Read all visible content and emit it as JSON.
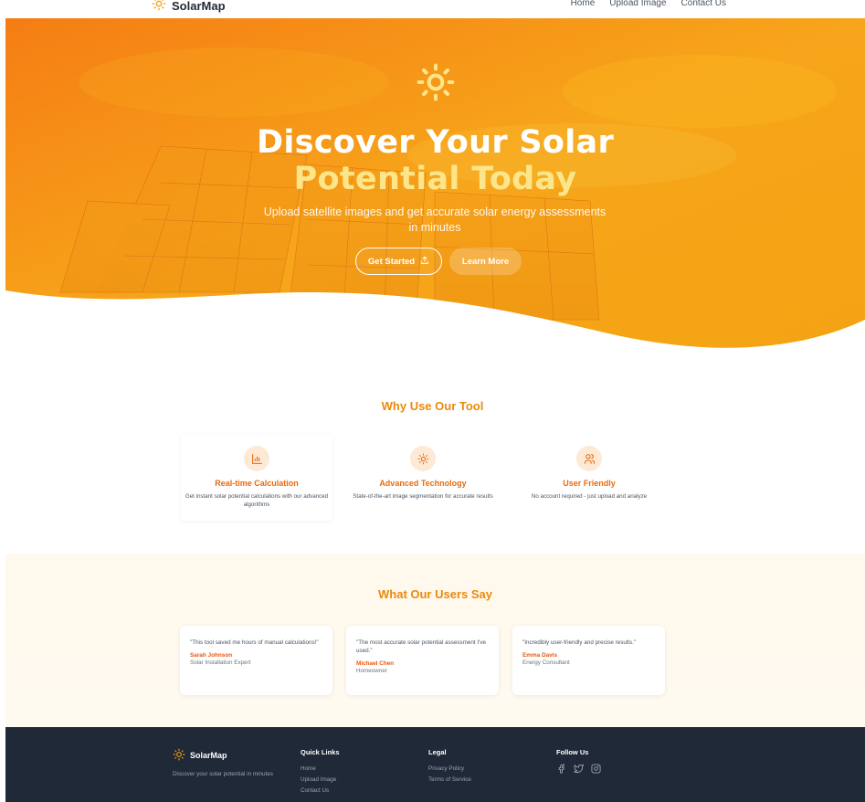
{
  "nav": {
    "brand": "SolarMap",
    "links": [
      "Home",
      "Upload Image",
      "Contact Us"
    ]
  },
  "hero": {
    "title_line1": "Discover Your Solar",
    "title_line2": "Potential Today",
    "subtitle": "Upload satellite images and get accurate solar energy assessments in minutes",
    "primary_button": "Get Started",
    "secondary_button": "Learn More"
  },
  "why": {
    "title": "Why Use Our Tool",
    "features": [
      {
        "title": "Real-time Calculation",
        "desc": "Get instant solar potential calculations with our advanced algorithms",
        "icon": "bar-chart-icon"
      },
      {
        "title": "Advanced Technology",
        "desc": "State-of-the-art image segmentation for accurate results",
        "icon": "sun-icon"
      },
      {
        "title": "User Friendly",
        "desc": "No account required - just upload and analyze",
        "icon": "users-icon"
      }
    ]
  },
  "testimonials": {
    "title": "What Our Users Say",
    "items": [
      {
        "quote": "\"This tool saved me hours of manual calculations!\"",
        "name": "Sarah Johnson",
        "role": "Solar Installation Expert"
      },
      {
        "quote": "\"The most accurate solar potential assessment I've used.\"",
        "name": "Michael Chen",
        "role": "Homeowner"
      },
      {
        "quote": "\"Incredibly user-friendly and precise results.\"",
        "name": "Emma Davis",
        "role": "Energy Consultant"
      }
    ]
  },
  "footer": {
    "brand": "SolarMap",
    "tagline": "Discover your solar potential in minutes",
    "quick_links_title": "Quick Links",
    "quick_links": [
      "Home",
      "Upload Image",
      "Contact Us"
    ],
    "legal_title": "Legal",
    "legal_links": [
      "Privacy Policy",
      "Terms of Service"
    ],
    "follow_title": "Follow Us",
    "socials": [
      "facebook-icon",
      "twitter-icon",
      "instagram-icon"
    ]
  },
  "colors": {
    "accent": "#ea8a0c",
    "accent_dark": "#ea580c",
    "hero_orange": "#f59e0b",
    "footer_bg": "#1f2937"
  }
}
